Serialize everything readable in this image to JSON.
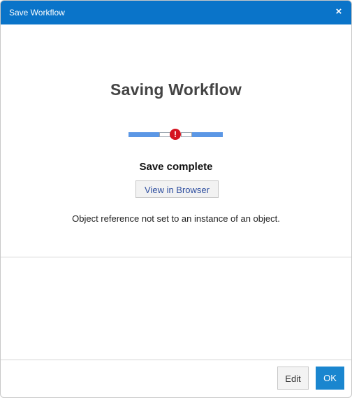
{
  "window": {
    "title": "Save Workflow",
    "close_glyph": "×"
  },
  "main": {
    "heading": "Saving Workflow",
    "progress": {
      "error_glyph": "!",
      "accent_color": "#5b97e5",
      "error_color": "#d51320"
    },
    "status": "Save complete",
    "view_button_label": "View in Browser",
    "error_message": "Object reference not set to an instance of an object."
  },
  "footer": {
    "edit_label": "Edit",
    "ok_label": "OK"
  },
  "colors": {
    "titlebar": "#0a74c9",
    "primary_button": "#1a86cf"
  }
}
